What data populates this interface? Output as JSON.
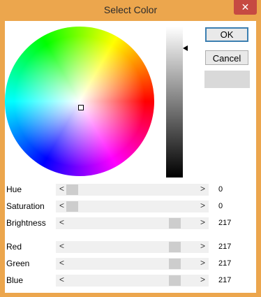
{
  "window": {
    "title": "Select Color",
    "close_label": "✕"
  },
  "buttons": {
    "ok": "OK",
    "cancel": "Cancel"
  },
  "sliders": [
    {
      "label": "Hue",
      "value": "0"
    },
    {
      "label": "Saturation",
      "value": "0"
    },
    {
      "label": "Brightness",
      "value": "217"
    },
    {
      "label": "Red",
      "value": "217"
    },
    {
      "label": "Green",
      "value": "217"
    },
    {
      "label": "Blue",
      "value": "217"
    }
  ],
  "arrows": {
    "left": "<",
    "right": ">"
  },
  "colors": {
    "title_bar": "#eca64d",
    "close_button": "#c64a42",
    "selected_color": "#d9d9d9"
  }
}
